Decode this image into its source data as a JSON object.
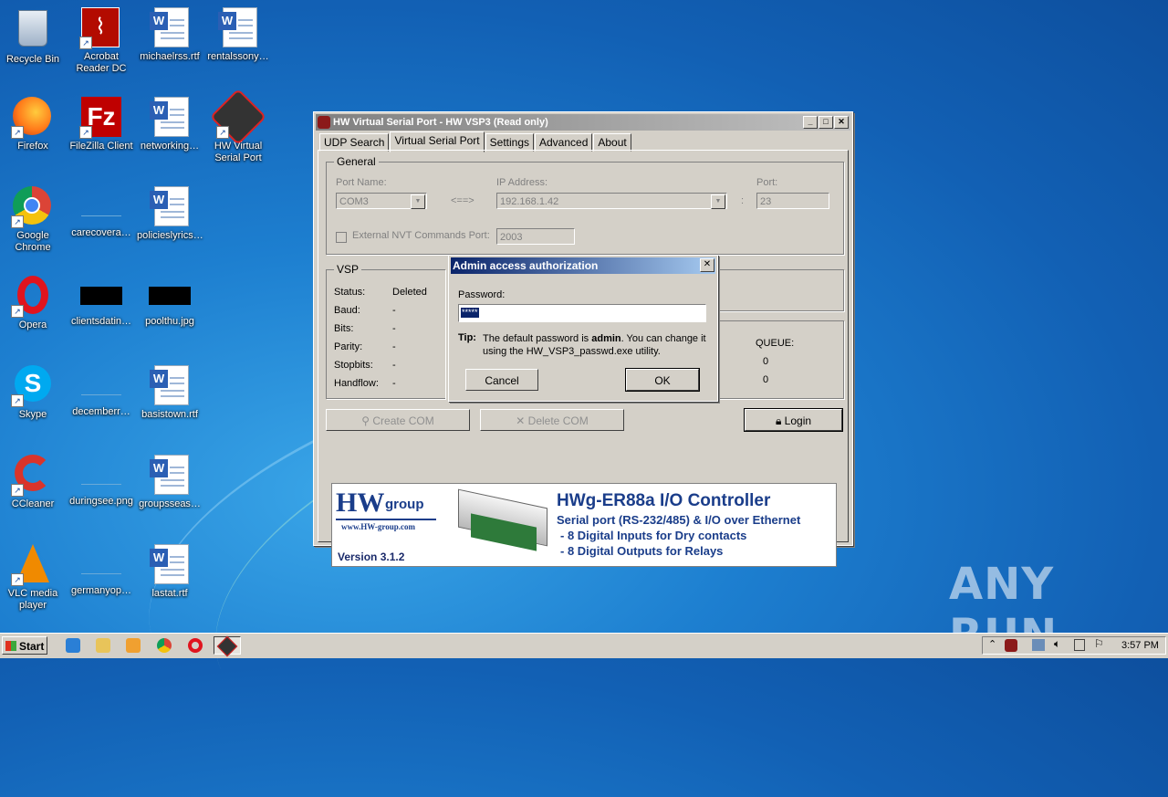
{
  "desktop": {
    "icons": [
      {
        "label": "Recycle Bin"
      },
      {
        "label": "Acrobat Reader DC"
      },
      {
        "label": "michaelrss.rtf"
      },
      {
        "label": "rentalssony…"
      },
      {
        "label": "Firefox"
      },
      {
        "label": "FileZilla Client"
      },
      {
        "label": "networking…"
      },
      {
        "label": "HW Virtual Serial Port"
      },
      {
        "label": "Google Chrome"
      },
      {
        "label": "carecovera…"
      },
      {
        "label": "policieslyrics…"
      },
      {
        "label": "Opera"
      },
      {
        "label": "clientsdatin…"
      },
      {
        "label": "poolthu.jpg"
      },
      {
        "label": "Skype"
      },
      {
        "label": "decemberr…"
      },
      {
        "label": "basistown.rtf"
      },
      {
        "label": "CCleaner"
      },
      {
        "label": "duringsee.png"
      },
      {
        "label": "groupsseas…"
      },
      {
        "label": "VLC media player"
      },
      {
        "label": "germanyop…"
      },
      {
        "label": "lastat.rtf"
      }
    ],
    "watermark": "ANY RUN"
  },
  "window": {
    "title": "HW Virtual Serial Port - HW VSP3 (Read only)",
    "tabs": [
      {
        "label": "UDP Search"
      },
      {
        "label": "Virtual Serial Port"
      },
      {
        "label": "Settings"
      },
      {
        "label": "Advanced"
      },
      {
        "label": "About"
      }
    ],
    "general": {
      "title": "General",
      "port_name_label": "Port Name:",
      "port_name_value": "COM3",
      "arrow_text": "<==>",
      "ip_label": "IP Address:",
      "ip_value": "192.168.1.42",
      "colon": ":",
      "port_label": "Port:",
      "port_value": "23",
      "nvt_label": "External NVT Commands Port:",
      "nvt_value": "2003"
    },
    "vsp": {
      "title": "VSP",
      "rows": [
        {
          "label": "Status:",
          "value": "Deleted"
        },
        {
          "label": "Baud:",
          "value": "-"
        },
        {
          "label": "Bits:",
          "value": "-"
        },
        {
          "label": "Parity:",
          "value": "-"
        },
        {
          "label": "Stopbits:",
          "value": "-"
        },
        {
          "label": "Handflow:",
          "value": "-"
        }
      ],
      "queue_label": "QUEUE:",
      "queue_values": [
        "0",
        "0"
      ]
    },
    "buttons": {
      "create": "Create COM",
      "delete": "Delete COM",
      "login": "Login"
    },
    "banner": {
      "logo_hw": "HW",
      "logo_group": "group",
      "url": "www.HW-group.com",
      "version": "Version  3.1.2",
      "product": "HWg-ER88a  I/O Controller",
      "line1": "Serial port (RS-232/485) & I/O over Ethernet",
      "line2": "- 8 Digital Inputs for Dry contacts",
      "line3": "- 8 Digital Outputs for Relays"
    }
  },
  "dialog": {
    "title": "Admin access authorization",
    "password_label": "Password:",
    "password_value": "*****",
    "tip_label": "Tip:",
    "tip_text_1": "The default password is",
    "tip_bold": "admin",
    "tip_text_2": ". You can change it",
    "tip_text_3": "using the HW_VSP3_passwd.exe utility.",
    "cancel": "Cancel",
    "ok": "OK"
  },
  "taskbar": {
    "start": "Start",
    "clock": "3:57 PM"
  }
}
